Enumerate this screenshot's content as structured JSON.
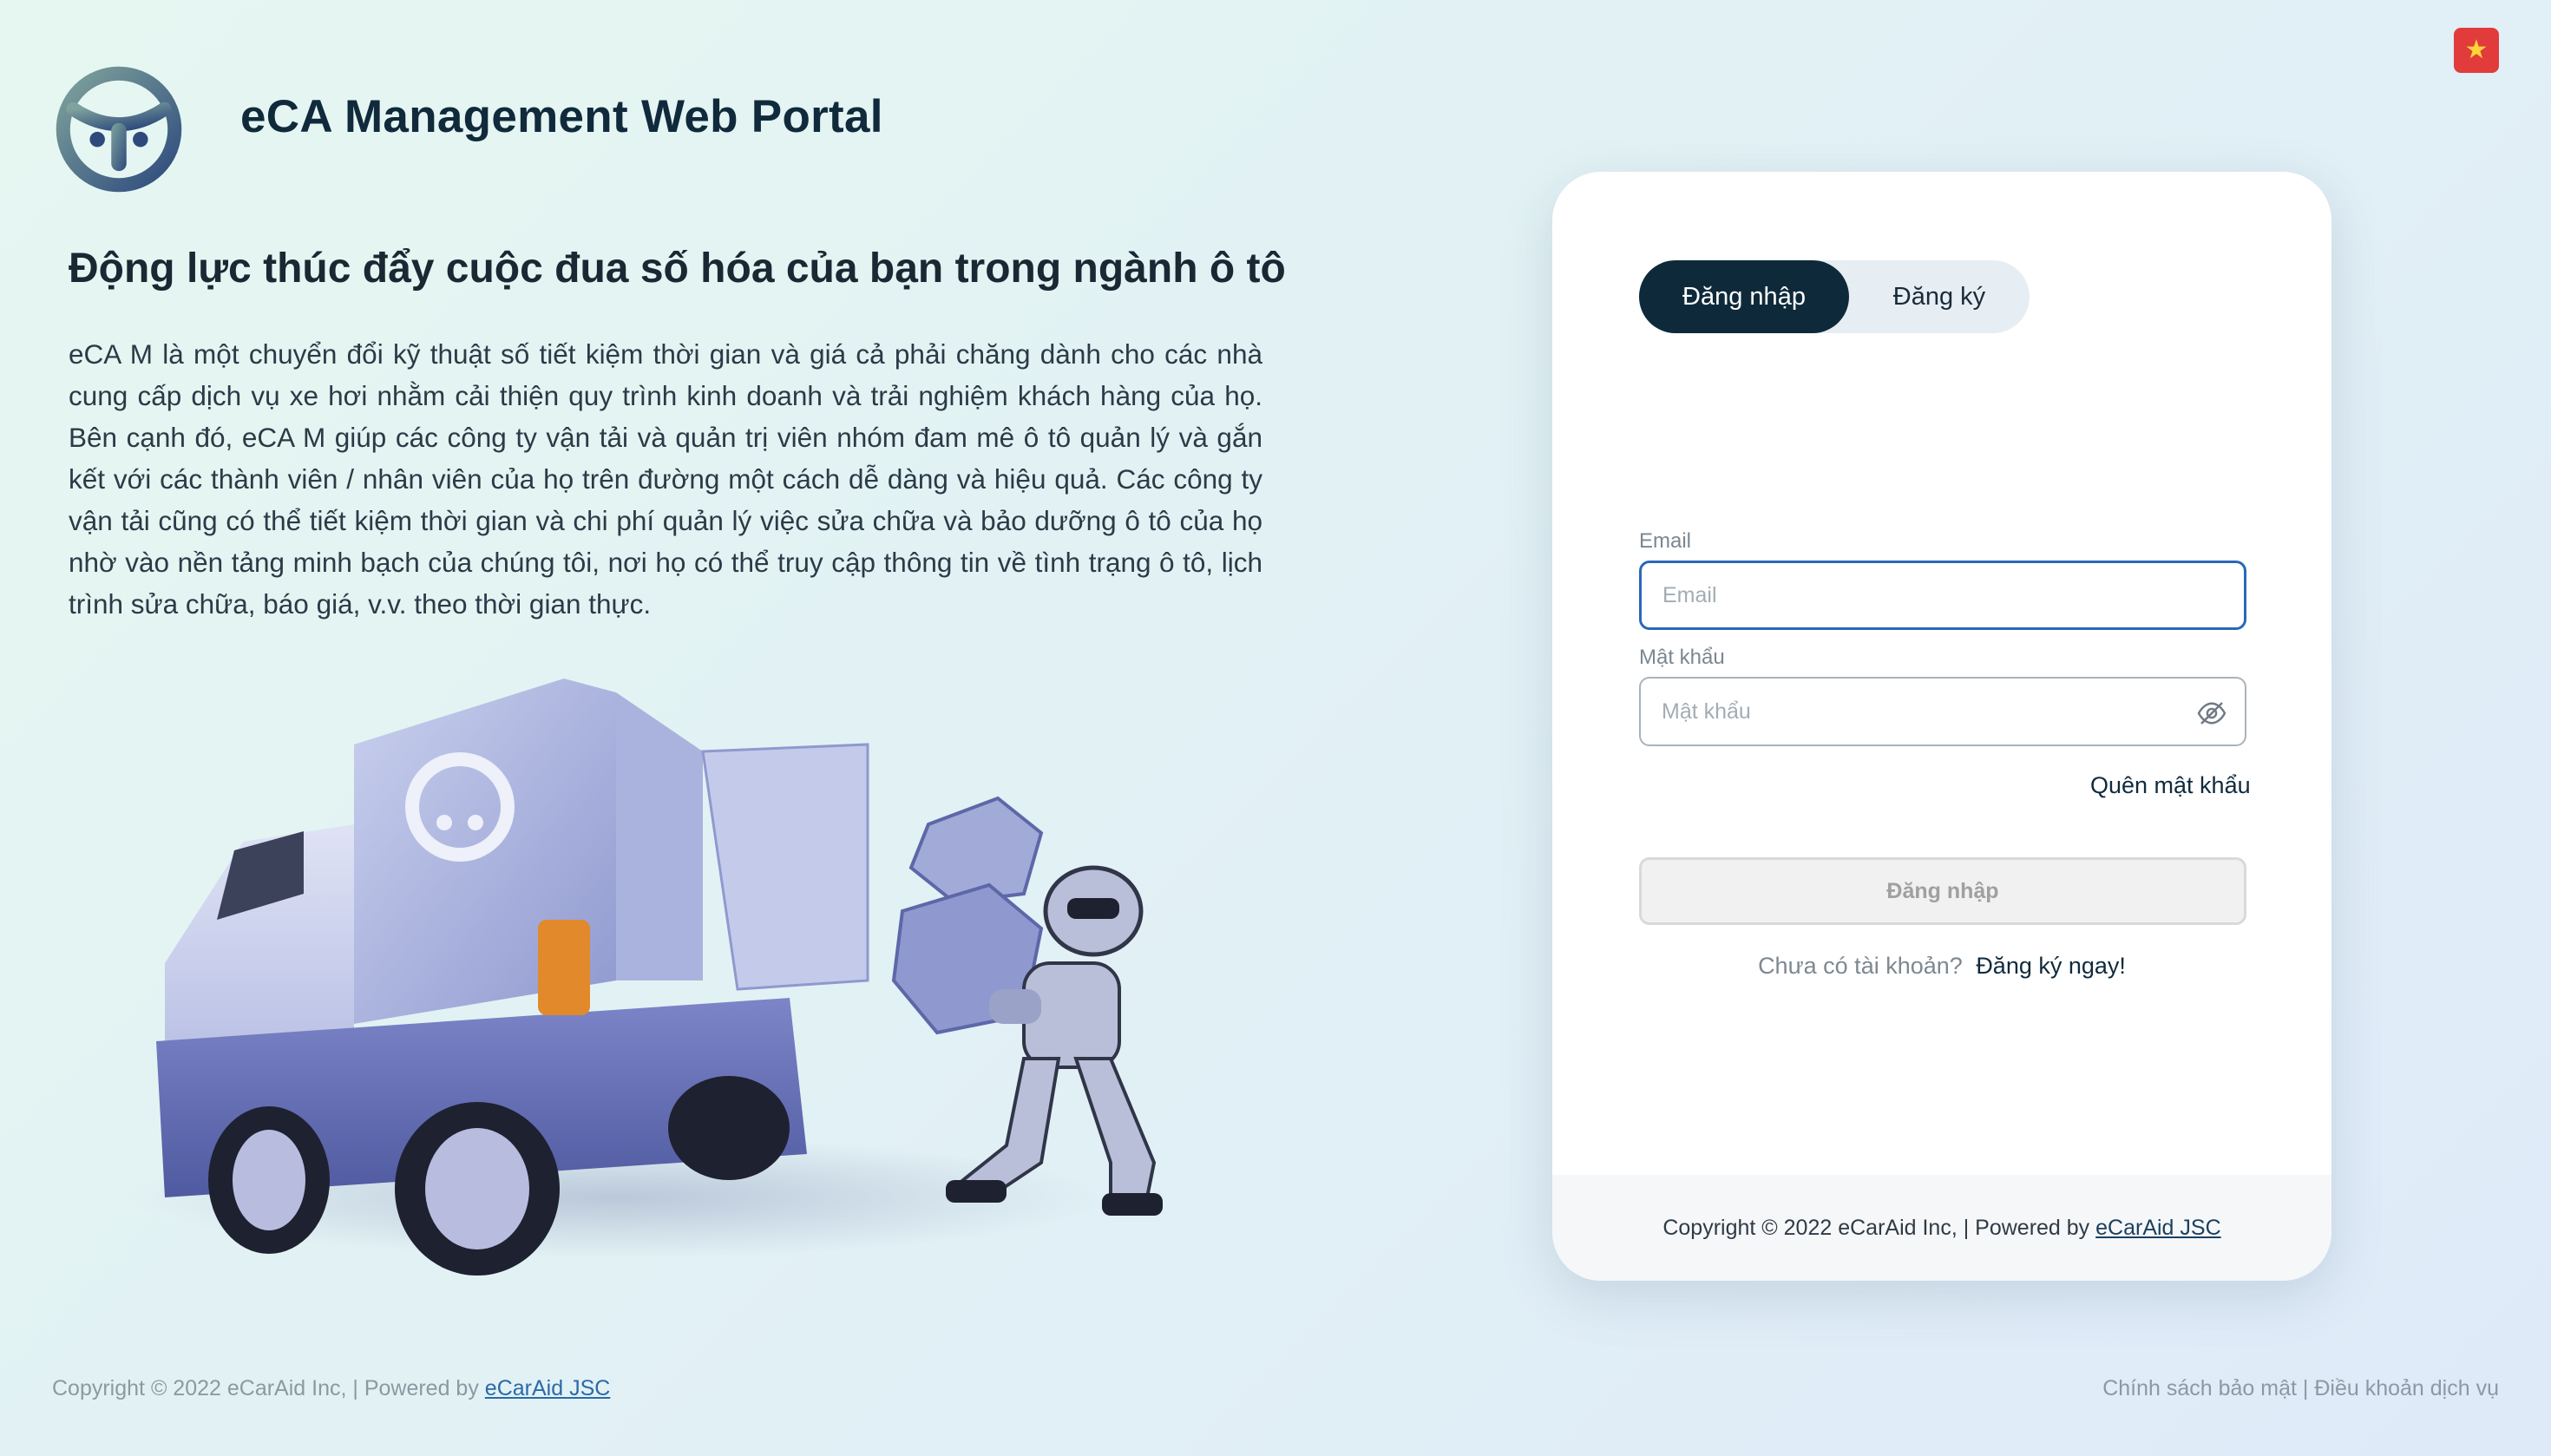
{
  "header": {
    "title": "eCA Management Web Portal",
    "language_flag_icon": "vietnam-flag-icon"
  },
  "hero": {
    "headline": "Động lực thúc đẩy cuộc đua số hóa của bạn trong ngành ô tô",
    "description": "eCA M là một chuyển đổi kỹ thuật số tiết kiệm thời gian và giá cả phải chăng dành cho các nhà cung cấp dịch vụ xe hơi nhằm cải thiện quy trình kinh doanh và trải nghiệm khách hàng của họ. Bên cạnh đó, eCA M giúp các công ty vận tải và quản trị viên nhóm đam mê ô tô quản lý và gắn kết với các thành viên / nhân viên của họ trên đường một cách dễ dàng và hiệu quả. Các công ty vận tải cũng có thể tiết kiệm thời gian và chi phí quản lý việc sửa chữa và bảo dưỡng ô tô của họ nhờ vào nền tảng minh bạch của chúng tôi, nơi họ có thể truy cập thông tin về tình trạng ô tô, lịch trình sửa chữa, báo giá, v.v. theo thời gian thực."
  },
  "login_card": {
    "tabs": [
      {
        "label": "Đăng nhập",
        "active": true
      },
      {
        "label": "Đăng ký",
        "active": false
      }
    ],
    "email": {
      "label": "Email",
      "placeholder": "Email",
      "value": ""
    },
    "password": {
      "label": "Mật khẩu",
      "placeholder": "Mật khẩu",
      "value": "",
      "toggle_icon": "eye-slash-icon"
    },
    "forgot_password": "Quên mật khẩu",
    "submit_label": "Đăng nhập",
    "signup_question": "Chưa có tài khoản?",
    "signup_link": "Đăng ký ngay!",
    "footer": {
      "copyright": "Copyright © 2022 eCarAid Inc, | Powered by",
      "company_link": "eCarAid JSC"
    }
  },
  "page_footer": {
    "copyright": "Copyright © 2022 eCarAid Inc, | Powered by",
    "company_link": "eCarAid JSC",
    "privacy_policy": "Chính sách bảo mật",
    "separator": "|",
    "terms": "Điều khoản dịch vụ"
  },
  "colors": {
    "primary_dark": "#0e2a3a",
    "email_focus_border": "#2868b8",
    "link_blue": "#2a6aa8",
    "flag_red": "#e23b3b",
    "flag_star": "#ffd43b"
  }
}
